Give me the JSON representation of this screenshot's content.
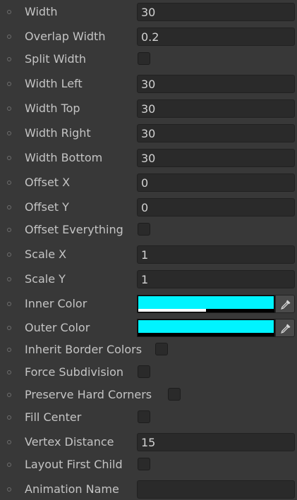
{
  "accent_color": "#00f4ff",
  "fields": {
    "width": {
      "label": "Width",
      "value": "30"
    },
    "overlap_width": {
      "label": "Overlap Width",
      "value": "0.2"
    },
    "split_width": {
      "label": "Split Width",
      "checked": false
    },
    "width_left": {
      "label": "Width Left",
      "value": "30"
    },
    "width_top": {
      "label": "Width Top",
      "value": "30"
    },
    "width_right": {
      "label": "Width Right",
      "value": "30"
    },
    "width_bottom": {
      "label": "Width Bottom",
      "value": "30"
    },
    "offset_x": {
      "label": "Offset X",
      "value": "0"
    },
    "offset_y": {
      "label": "Offset Y",
      "value": "0"
    },
    "offset_everything": {
      "label": "Offset Everything",
      "checked": false
    },
    "scale_x": {
      "label": "Scale X",
      "value": "1"
    },
    "scale_y": {
      "label": "Scale Y",
      "value": "1"
    },
    "inner_color": {
      "label": "Inner Color",
      "color": "#00f4ff",
      "alpha": 0.5,
      "picker_icon": "eyedropper-icon"
    },
    "outer_color": {
      "label": "Outer Color",
      "color": "#00f4ff",
      "alpha": 0.0,
      "picker_icon": "eyedropper-icon"
    },
    "inherit_border_colors": {
      "label": "Inherit Border Colors",
      "checked": false
    },
    "force_subdivision": {
      "label": "Force Subdivision",
      "checked": false
    },
    "preserve_hard_corners": {
      "label": "Preserve Hard Corners",
      "checked": false
    },
    "fill_center": {
      "label": "Fill Center",
      "checked": false
    },
    "vertex_distance": {
      "label": "Vertex Distance",
      "value": "15"
    },
    "layout_first_child": {
      "label": "Layout First Child",
      "checked": false
    },
    "animation_name": {
      "label": "Animation Name",
      "value": ""
    }
  }
}
